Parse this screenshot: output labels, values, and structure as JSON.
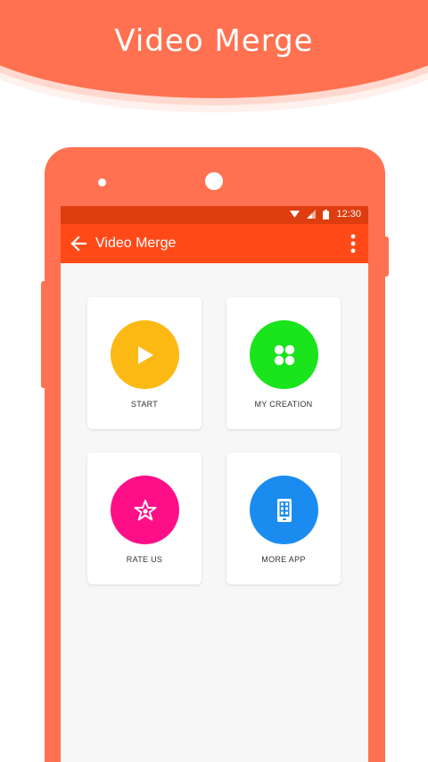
{
  "banner": {
    "title": "Video Merge"
  },
  "statusbar": {
    "time": "12:30"
  },
  "appbar": {
    "title": "Video Merge"
  },
  "menu": {
    "start": {
      "label": "START",
      "color": "#fdb913"
    },
    "my_creation": {
      "label": "MY CREATION",
      "color": "#19e41c"
    },
    "rate_us": {
      "label": "RATE US",
      "color": "#ff0f87"
    },
    "more_app": {
      "label": "MORE APP",
      "color": "#1a8cf0"
    }
  },
  "colors": {
    "brand": "#ff7150",
    "appbar": "#ff4a18",
    "statusbar": "#dd3d0f"
  },
  "icons": {
    "start": "play-icon",
    "my_creation": "grid-icon",
    "rate_us": "star-icon",
    "more_app": "phone-icon"
  }
}
